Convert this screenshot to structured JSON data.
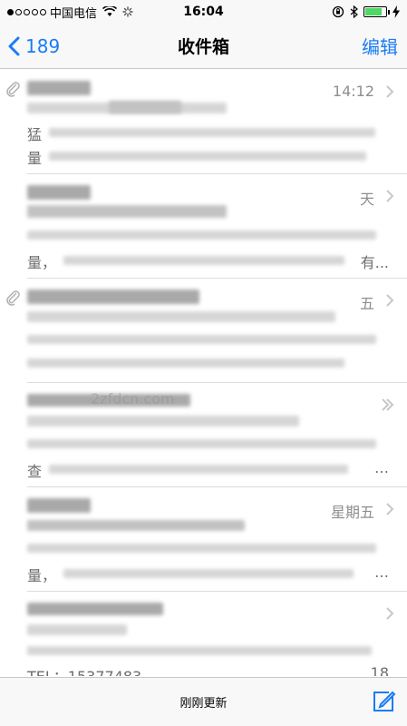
{
  "status_bar": {
    "carrier": "中国电信",
    "time": "16:04",
    "battery_level": 0.8
  },
  "nav": {
    "back_label": "189",
    "title": "收件箱",
    "edit_label": "编辑"
  },
  "mails": [
    {
      "date": "14:12",
      "attachment": true,
      "preview_start": "猛",
      "preview_start2": "量"
    },
    {
      "date": "天",
      "attachment": false,
      "preview_start": "",
      "preview_start2": "量，",
      "preview_end": "有..."
    },
    {
      "date": "五",
      "attachment": true,
      "preview_start": "",
      "preview_start2": ""
    },
    {
      "date": "",
      "attachment": false,
      "preview_start": "",
      "preview_start2": "查",
      "watermark": "2zfdcn.com"
    },
    {
      "date": "星期五",
      "attachment": false,
      "preview_start": "",
      "preview_start2": "量，"
    },
    {
      "date": "",
      "attachment": false,
      "preview_start": "",
      "preview_start2": "TEL：15377483",
      "preview_end": "18"
    }
  ],
  "toolbar": {
    "status": "刚刚更新"
  },
  "colors": {
    "accent": "#1a7cf5",
    "battery": "#4cd964"
  },
  "icons": [
    "wifi-icon",
    "activity-icon",
    "lock-rotation-icon",
    "bluetooth-icon",
    "battery-icon",
    "charging-icon",
    "chevron-left-icon",
    "paperclip-icon",
    "chevron-right-icon",
    "compose-icon"
  ]
}
